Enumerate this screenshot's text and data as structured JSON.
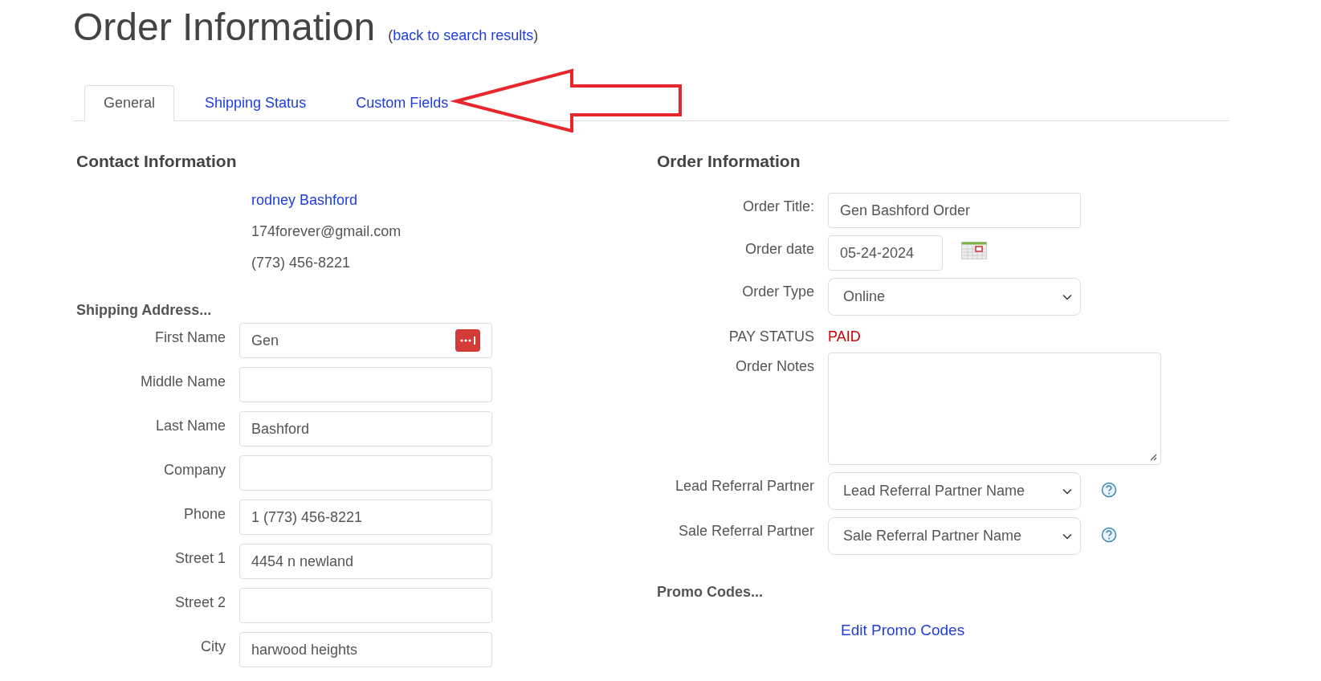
{
  "header": {
    "title": "Order Information",
    "paren_open": "(",
    "back_link": "back to search results",
    "paren_close": ")"
  },
  "tabs": [
    {
      "label": "General",
      "selected": true
    },
    {
      "label": "Shipping Status",
      "selected": false
    },
    {
      "label": "Custom Fields",
      "selected": false
    }
  ],
  "annotation": {
    "kind": "arrow"
  },
  "contact": {
    "heading": "Contact Information",
    "name": "rodney Bashford",
    "email": "174forever@gmail.com",
    "phone": "(773) 456-8221"
  },
  "shipping": {
    "heading": "Shipping Address...",
    "fields": [
      {
        "kind": "autofill",
        "label": "First Name",
        "value": "Gen"
      },
      {
        "kind": "text",
        "label": "Middle Name"
      },
      {
        "kind": "text",
        "label": "Last Name",
        "value": "Bashford"
      },
      {
        "kind": "text",
        "label": "Company"
      },
      {
        "kind": "text",
        "label": "Phone",
        "value": "1 (773) 456-8221"
      },
      {
        "kind": "text",
        "label": "Street 1",
        "value": "4454 n newland"
      },
      {
        "kind": "text",
        "label": "Street 2"
      },
      {
        "kind": "text",
        "label": "City",
        "value": "harwood heights"
      }
    ]
  },
  "order": {
    "heading": "Order Information",
    "fields": [
      {
        "kind": "text",
        "label": "Order Title:",
        "value": "Gen Bashford Order"
      },
      {
        "kind": "date",
        "label": "Order date",
        "value": "05-24-2024"
      },
      {
        "kind": "select",
        "label": "Order Type",
        "value": "Online"
      },
      {
        "kind": "status",
        "label": "PAY STATUS",
        "value": "PAID",
        "color": "#cc0000"
      },
      {
        "kind": "textarea",
        "label": "Order Notes"
      },
      {
        "kind": "select_help",
        "label": "Lead Referral Partner",
        "value": "Lead Referral Partner Name"
      },
      {
        "kind": "select_help",
        "label": "Sale Referral Partner",
        "value": "Sale Referral Partner Name"
      }
    ]
  },
  "promo": {
    "heading": "Promo Codes...",
    "link": "Edit Promo Codes"
  }
}
